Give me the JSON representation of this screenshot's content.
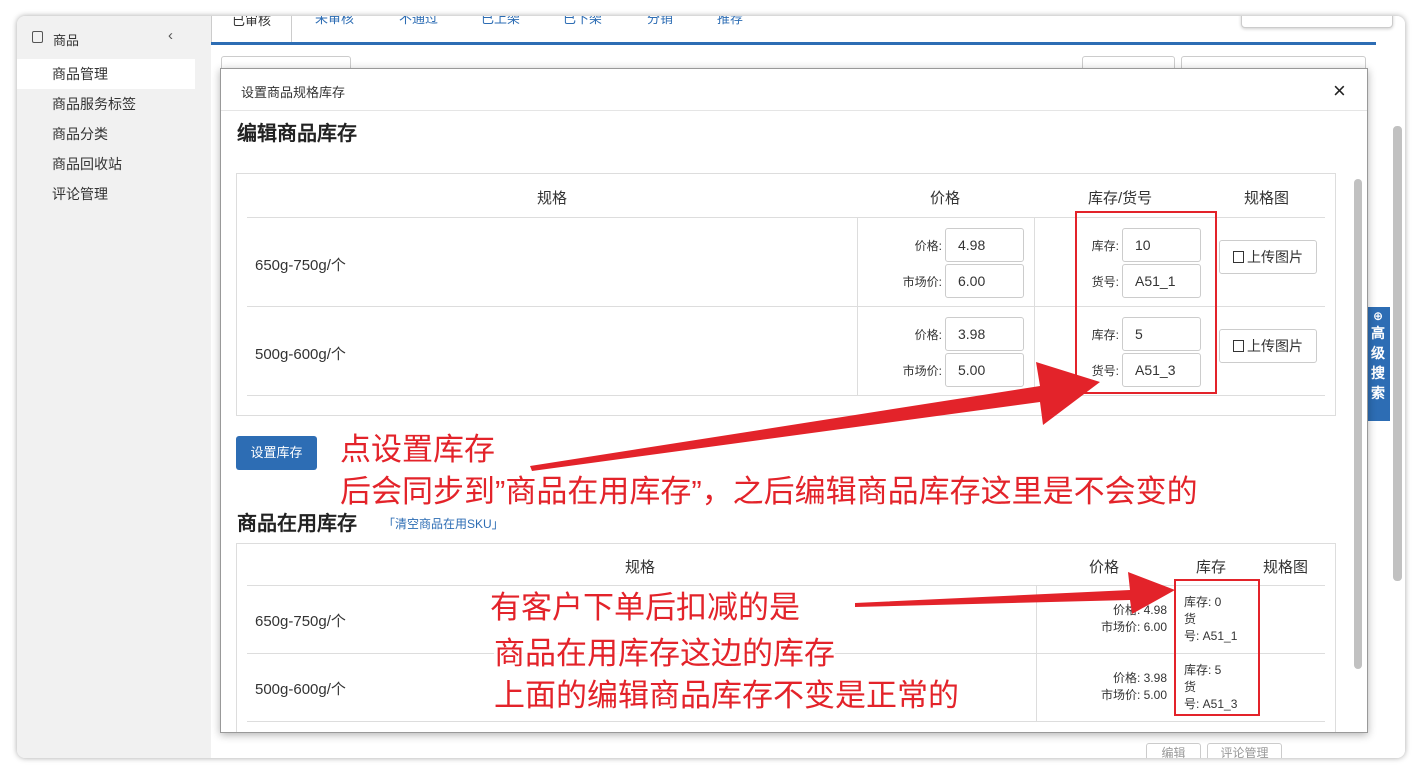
{
  "sidebar": {
    "header": "商品",
    "items": [
      "商品管理",
      "商品服务标签",
      "商品分类",
      "商品回收站",
      "评论管理"
    ]
  },
  "tabs": [
    "已审核",
    "未审核",
    "不通过",
    "已上架",
    "已下架",
    "分销",
    "推荐"
  ],
  "advanced_search": "高级搜索",
  "background_buttons": {
    "edit": "编辑",
    "comments": "评论管理"
  },
  "modal": {
    "title": "设置商品规格库存",
    "close": "×",
    "edit_section": {
      "heading": "编辑商品库存",
      "columns": [
        "规格",
        "价格",
        "库存/货号",
        "规格图"
      ],
      "rows": [
        {
          "spec": "650g-750g/个",
          "price_label": "价格:",
          "price": "4.98",
          "market_label": "市场价:",
          "market": "6.00",
          "stock_label": "库存:",
          "stock": "10",
          "sku_label": "货号:",
          "sku": "A51_1",
          "upload": "上传图片"
        },
        {
          "spec": "500g-600g/个",
          "price_label": "价格:",
          "price": "3.98",
          "market_label": "市场价:",
          "market": "5.00",
          "stock_label": "库存:",
          "stock": "5",
          "sku_label": "货号:",
          "sku": "A51_3",
          "upload": "上传图片"
        }
      ],
      "set_button": "设置库存"
    },
    "active_section": {
      "heading": "商品在用库存",
      "clear_link": "「清空商品在用SKU」",
      "columns": [
        "规格",
        "价格",
        "库存",
        "规格图"
      ],
      "rows": [
        {
          "spec": "650g-750g/个",
          "price_line": "价格: 4.98",
          "market_line": "市场价: 6.00",
          "stock_line": "库存: 0",
          "sku_line1": "货",
          "sku_line2": "号: A51_1"
        },
        {
          "spec": "500g-600g/个",
          "price_line": "价格: 3.98",
          "market_line": "市场价: 5.00",
          "stock_line": "库存: 5",
          "sku_line1": "货",
          "sku_line2": "号: A51_3"
        }
      ]
    }
  },
  "annotations": {
    "top_line1": "点设置库存",
    "top_line2": "后会同步到”商品在用库存”，之后编辑商品库存这里是不会变的",
    "bottom_line1": "有客户下单后扣减的是",
    "bottom_line2": "商品在用库存这边的库存",
    "bottom_line3": "上面的编辑商品库存不变是正常的",
    "color": "#e3232a"
  }
}
